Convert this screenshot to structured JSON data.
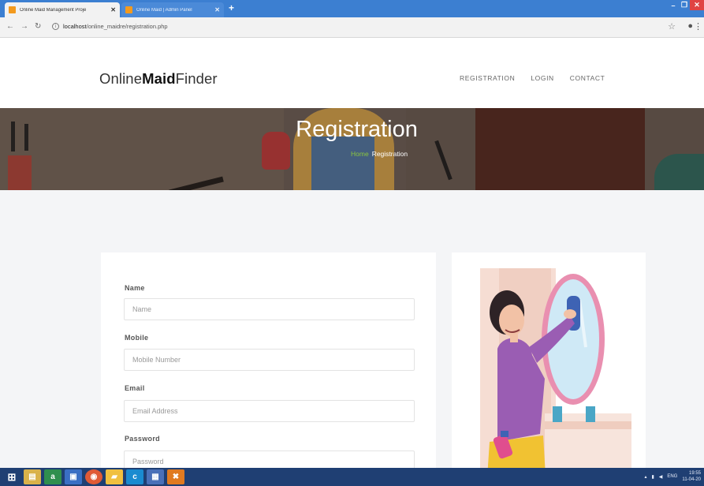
{
  "browser": {
    "tabs": [
      {
        "title": "Online Maid Management Proje",
        "active": true
      },
      {
        "title": "Online Maid | Admin Panel",
        "active": false
      }
    ],
    "url_host": "localhost",
    "url_path": "/online_maidre/registration.php"
  },
  "site": {
    "logo_prefix": "Online",
    "logo_bold": "Maid",
    "logo_suffix": "Finder",
    "nav": [
      "REGISTRATION",
      "LOGIN",
      "CONTACT"
    ]
  },
  "hero": {
    "title": "Registration",
    "crumb_home": "Home",
    "crumb_current": "Registration"
  },
  "form": {
    "fields": [
      {
        "label": "Name",
        "placeholder": "Name"
      },
      {
        "label": "Mobile",
        "placeholder": "Mobile Number"
      },
      {
        "label": "Email",
        "placeholder": "Email Address"
      },
      {
        "label": "Password",
        "placeholder": "Password"
      }
    ]
  },
  "taskbar": {
    "lang": "ENG",
    "time": "19:55",
    "date": "11-04-20"
  },
  "colors": {
    "tabbar": "#3c7fd1",
    "hero_accent": "#8cc63f",
    "taskbar": "#1f3f73"
  }
}
